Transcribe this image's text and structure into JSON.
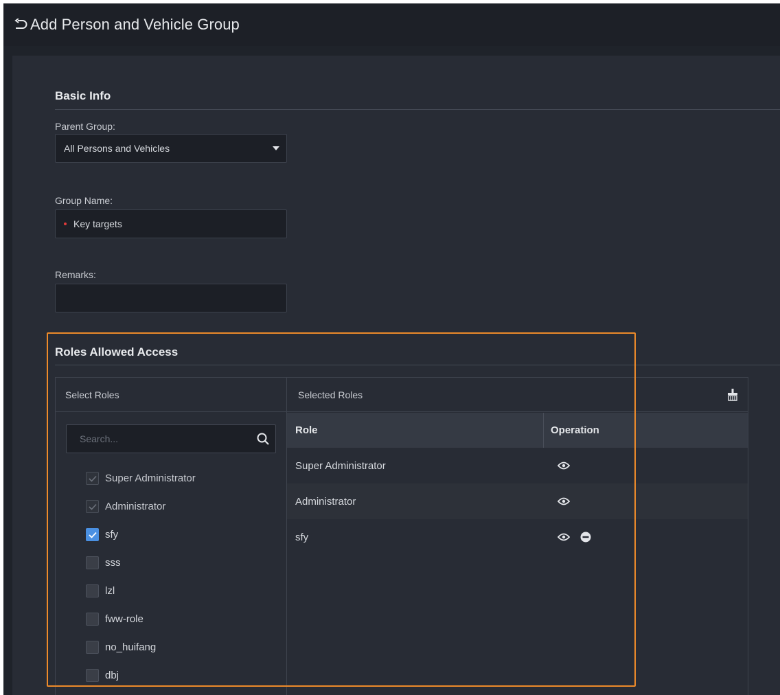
{
  "header": {
    "title": "Add Person and Vehicle Group"
  },
  "basic_info": {
    "section_title": "Basic Info",
    "parent_group": {
      "label": "Parent Group:",
      "value": "All Persons and Vehicles"
    },
    "group_name": {
      "label": "Group Name:",
      "value": "Key targets",
      "required": true
    },
    "remarks": {
      "label": "Remarks:",
      "value": ""
    }
  },
  "roles": {
    "section_title": "Roles Allowed Access",
    "select_header": "Select Roles",
    "selected_header": "Selected Roles",
    "search_placeholder": "Search...",
    "items": [
      {
        "label": "Super Administrator",
        "state": "checked-disabled"
      },
      {
        "label": "Administrator",
        "state": "checked-disabled"
      },
      {
        "label": "sfy",
        "state": "checked"
      },
      {
        "label": "sss",
        "state": "unchecked"
      },
      {
        "label": "lzl",
        "state": "unchecked"
      },
      {
        "label": "fww-role",
        "state": "unchecked"
      },
      {
        "label": "no_huifang",
        "state": "unchecked"
      },
      {
        "label": "dbj",
        "state": "unchecked"
      }
    ],
    "table": {
      "col_role": "Role",
      "col_operation": "Operation",
      "rows": [
        {
          "role": "Super Administrator",
          "ops": [
            "view-icon"
          ]
        },
        {
          "role": "Administrator",
          "ops": [
            "view-icon"
          ]
        },
        {
          "role": "sfy",
          "ops": [
            "view-icon",
            "remove-icon"
          ]
        }
      ]
    }
  },
  "colors": {
    "highlight": "#ee8b2a",
    "checkbox_checked": "#4a90e2",
    "required_dot": "#e03a3a",
    "background": "#282c35"
  }
}
